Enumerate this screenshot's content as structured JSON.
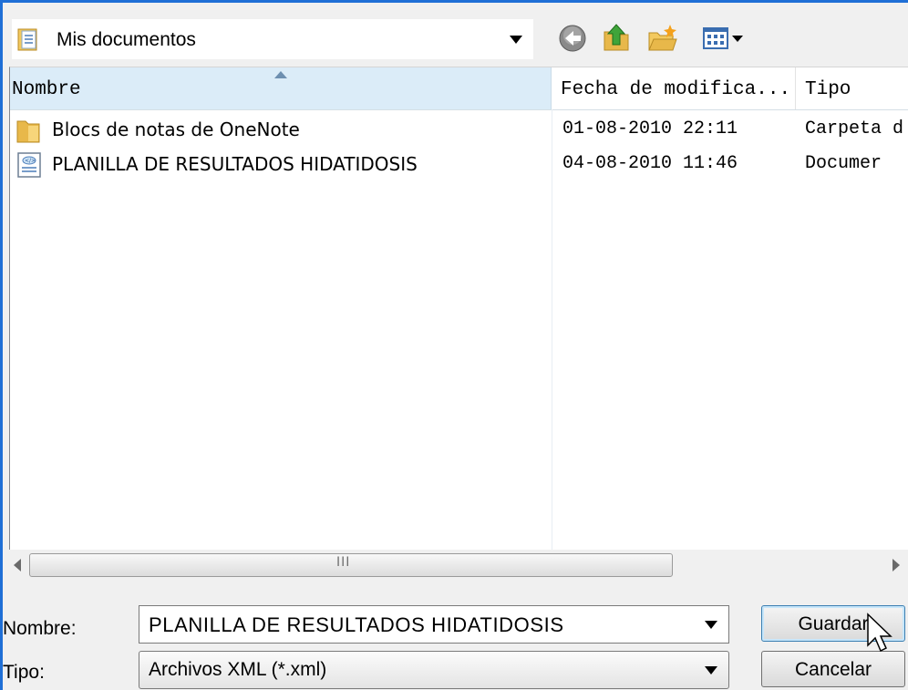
{
  "toolbar": {
    "location_label": "Mis documentos",
    "icons": [
      "folder-icon",
      "back-icon",
      "up-folder-icon",
      "new-folder-icon",
      "view-menu-icon"
    ]
  },
  "file_list": {
    "columns": {
      "name": "Nombre",
      "date": "Fecha de modifica...",
      "type": "Tipo"
    },
    "rows": [
      {
        "icon": "folder-icon",
        "name": "Blocs de notas de OneNote",
        "date": "01-08-2010 22:11",
        "type": "Carpeta d"
      },
      {
        "icon": "xml-document-icon",
        "name": "PLANILLA DE RESULTADOS  HIDATIDOSIS",
        "date": "04-08-2010 11:46",
        "type": "Documer"
      }
    ],
    "scrollbar_grip": "III"
  },
  "form": {
    "name_label": "Nombre:",
    "name_value": "PLANILLA DE RESULTADOS  HIDATIDOSIS",
    "type_label": "Tipo:",
    "type_value": "Archivos XML (*.xml)"
  },
  "buttons": {
    "save_label": "Guardar",
    "cancel_label": "Cancelar"
  },
  "colors": {
    "frame": "#1f6fd6",
    "header_selected": "#dbecf8",
    "folder": "#e8b84a",
    "back": "#7d7d7d"
  }
}
